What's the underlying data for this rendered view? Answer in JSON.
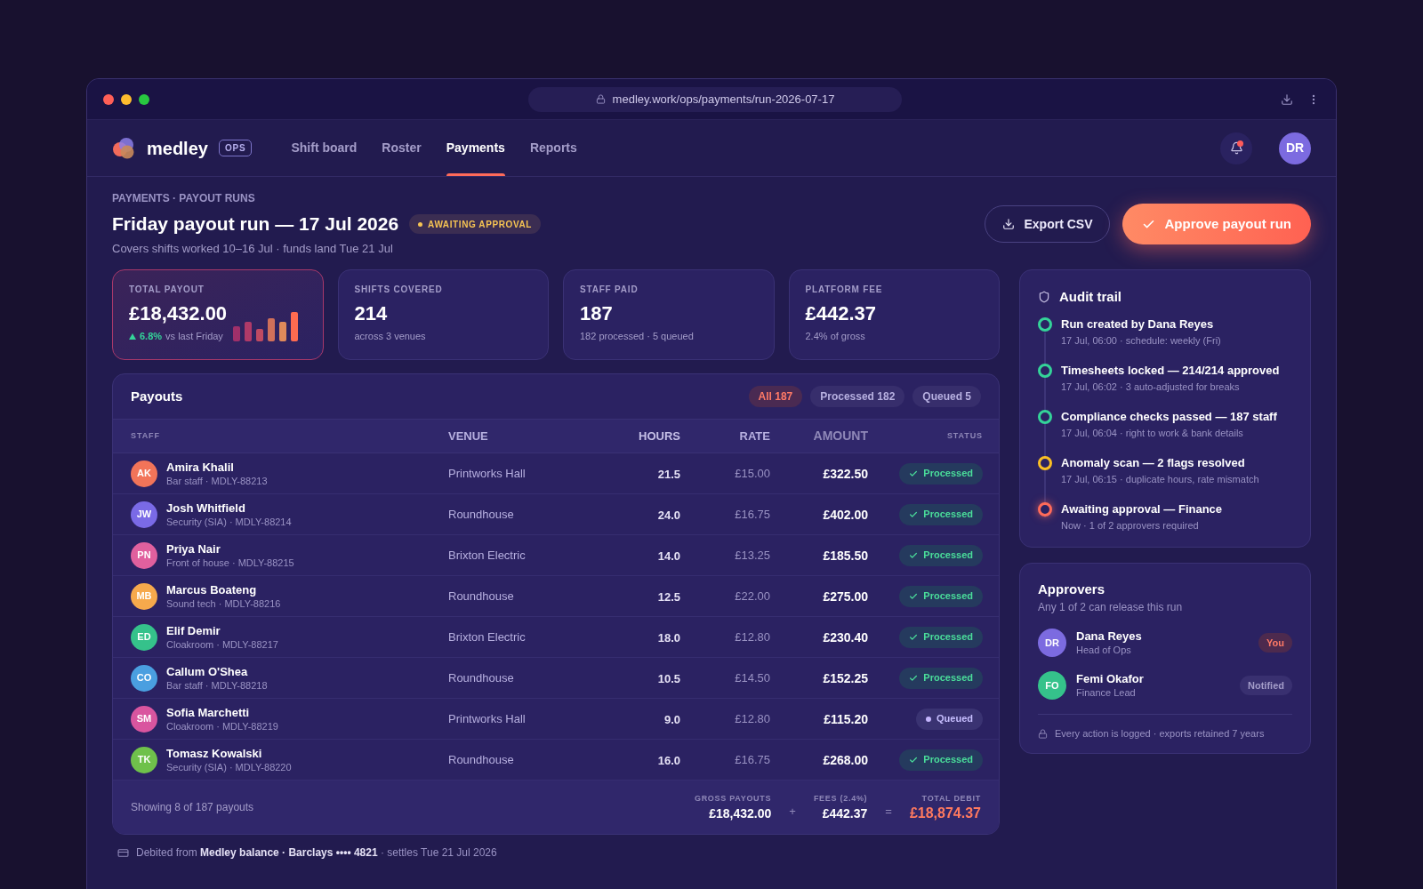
{
  "browser": {
    "url": "medley.work/ops/payments/run-2026-07-17"
  },
  "nav": {
    "brand": "medley",
    "badge": "OPS",
    "tabs": [
      {
        "label": "Shift board",
        "selected": false
      },
      {
        "label": "Roster",
        "selected": false
      },
      {
        "label": "Payments",
        "selected": true
      },
      {
        "label": "Reports",
        "selected": false
      }
    ],
    "notifications": {
      "unread": true
    },
    "avatar": "DR"
  },
  "header": {
    "breadcrumb": "PAYMENTS · PAYOUT RUNS",
    "title": "Friday payout run — 17 Jul 2026",
    "status": "AWAITING APPROVAL",
    "subtitle": "Covers shifts worked 10–16 Jul · funds land Tue 21 Jul",
    "actions": [
      {
        "kind": "secondary",
        "label": "Export CSV"
      },
      {
        "kind": "primary",
        "label": "Approve payout run"
      }
    ]
  },
  "stats": [
    {
      "label": "TOTAL PAYOUT",
      "value": "£18,432.00",
      "highlighted": true,
      "change": "6.8%",
      "note": "vs last Friday"
    },
    {
      "label": "SHIFTS COVERED",
      "value": "214",
      "highlighted": false,
      "note": "across 3 venues"
    },
    {
      "label": "STAFF PAID",
      "value": "187",
      "highlighted": false,
      "note": "182 processed · 5 queued"
    },
    {
      "label": "PLATFORM FEE",
      "value": "£442.37",
      "highlighted": false,
      "note": "2.4% of gross"
    }
  ],
  "payouts": {
    "title": "Payouts",
    "filters": [
      {
        "label": "All 187",
        "selected": true
      },
      {
        "label": "Processed 182",
        "selected": false
      },
      {
        "label": "Queued 5",
        "selected": false
      }
    ],
    "columns": [
      "STAFF",
      "VENUE",
      "HOURS",
      "RATE",
      "AMOUNT",
      "STATUS"
    ],
    "rows": [
      {
        "initials": "AK",
        "color": "#f27459",
        "name": "Amira Khalil",
        "detail": "Bar staff · MDLY-88213",
        "venue": "Printworks Hall",
        "hours": "21.5",
        "rate": "£15.00",
        "amount": "£322.50",
        "status": {
          "kind": "processed",
          "label": "Processed"
        }
      },
      {
        "initials": "JW",
        "color": "#7a6ae6",
        "name": "Josh Whitfield",
        "detail": "Security (SIA) · MDLY-88214",
        "venue": "Roundhouse",
        "hours": "24.0",
        "rate": "£16.75",
        "amount": "£402.00",
        "status": {
          "kind": "processed",
          "label": "Processed"
        }
      },
      {
        "initials": "PN",
        "color": "#e0609e",
        "name": "Priya Nair",
        "detail": "Front of house · MDLY-88215",
        "venue": "Brixton Electric",
        "hours": "14.0",
        "rate": "£13.25",
        "amount": "£185.50",
        "status": {
          "kind": "processed",
          "label": "Processed"
        }
      },
      {
        "initials": "MB",
        "color": "#f6a94c",
        "name": "Marcus Boateng",
        "detail": "Sound tech · MDLY-88216",
        "venue": "Roundhouse",
        "hours": "12.5",
        "rate": "£22.00",
        "amount": "£275.00",
        "status": {
          "kind": "processed",
          "label": "Processed"
        }
      },
      {
        "initials": "ED",
        "color": "#35c28b",
        "name": "Elif Demir",
        "detail": "Cloakroom · MDLY-88217",
        "venue": "Brixton Electric",
        "hours": "18.0",
        "rate": "£12.80",
        "amount": "£230.40",
        "status": {
          "kind": "processed",
          "label": "Processed"
        }
      },
      {
        "initials": "CO",
        "color": "#4a9fe0",
        "name": "Callum O'Shea",
        "detail": "Bar staff · MDLY-88218",
        "venue": "Roundhouse",
        "hours": "10.5",
        "rate": "£14.50",
        "amount": "£152.25",
        "status": {
          "kind": "processed",
          "label": "Processed"
        }
      },
      {
        "initials": "SM",
        "color": "#d9559f",
        "name": "Sofia Marchetti",
        "detail": "Cloakroom · MDLY-88219",
        "venue": "Printworks Hall",
        "hours": "9.0",
        "rate": "£12.80",
        "amount": "£115.20",
        "status": {
          "kind": "queued",
          "label": "Queued"
        }
      },
      {
        "initials": "TK",
        "color": "#6fc14b",
        "name": "Tomasz Kowalski",
        "detail": "Security (SIA) · MDLY-88220",
        "venue": "Roundhouse",
        "hours": "16.0",
        "rate": "£16.75",
        "amount": "£268.00",
        "status": {
          "kind": "processed",
          "label": "Processed"
        }
      }
    ],
    "footer": {
      "showing": "Showing 8 of 187 payouts",
      "totals": [
        {
          "kind": "plain",
          "label": "GROSS PAYOUTS",
          "value": "£18,432.00"
        },
        {
          "kind": "plain",
          "label": "FEES (2.4%)",
          "value": "£442.37"
        },
        {
          "kind": "total",
          "label": "TOTAL DEBIT",
          "value": "£18,874.37"
        }
      ],
      "operators": [
        "+",
        "="
      ]
    }
  },
  "debit_note": "Debited from **Medley balance · Barclays •••• 4821** · settles Tue 21 Jul 2026",
  "audit": {
    "title": "Audit trail",
    "events": [
      {
        "title": "Run created by Dana Reyes",
        "detail": "17 Jul, 06:00 · schedule: weekly (Fri)",
        "color": "#34d399",
        "current": false
      },
      {
        "title": "Timesheets locked — 214/214 approved",
        "detail": "17 Jul, 06:02 · 3 auto-adjusted for breaks",
        "color": "#34d399",
        "current": false
      },
      {
        "title": "Compliance checks passed — 187 staff",
        "detail": "17 Jul, 06:04 · right to work & bank details",
        "color": "#34d399",
        "current": false
      },
      {
        "title": "Anomaly scan — 2 flags resolved",
        "detail": "17 Jul, 06:15 · duplicate hours, rate mismatch",
        "color": "#fbbf24",
        "current": false
      },
      {
        "title": "Awaiting approval — Finance",
        "detail": "Now · 1 of 2 approvers required",
        "color": "#ff6b5a",
        "current": true
      }
    ]
  },
  "approvers": {
    "title": "Approvers",
    "subtitle": "Any 1 of 2 can release this run",
    "people": [
      {
        "initials": "DR",
        "color": "#7c6be0",
        "name": "Dana Reyes",
        "role": "Head of Ops",
        "tag": {
          "kind": "self",
          "label": "You"
        }
      },
      {
        "initials": "FO",
        "color": "#35c28b",
        "name": "Femi Okafor",
        "role": "Finance Lead",
        "tag": {
          "kind": "notified",
          "label": "Notified"
        }
      }
    ],
    "footnote": "Every action is logged · exports retained 7 years"
  }
}
